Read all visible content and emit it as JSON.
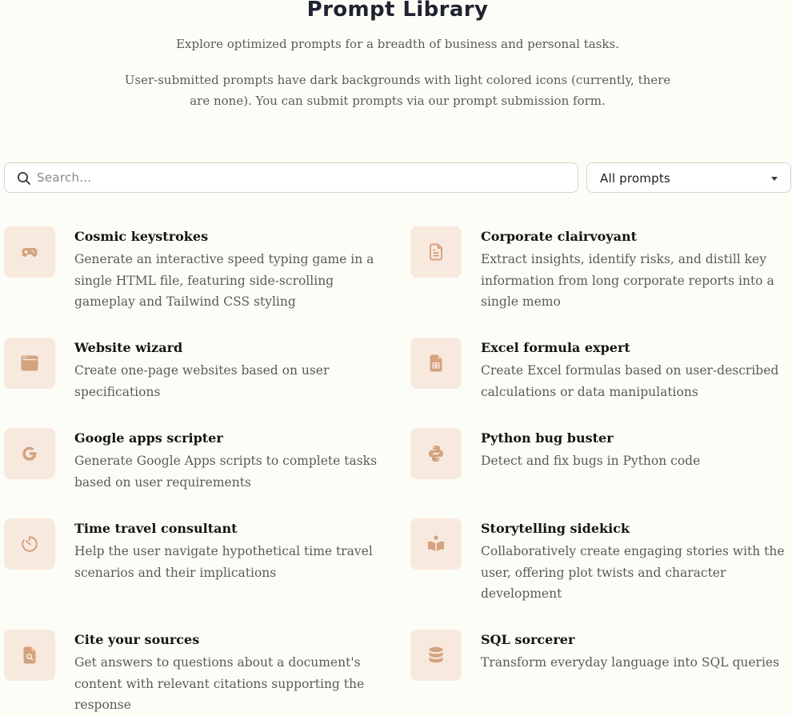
{
  "header": {
    "title": "Prompt Library",
    "subtitle": "Explore optimized prompts for a breadth of business and personal tasks.",
    "note": "User-submitted prompts have dark backgrounds with light colored icons (currently, there are none). You can submit prompts via our prompt submission form."
  },
  "search": {
    "placeholder": "Search...",
    "value": ""
  },
  "filter": {
    "selected": "All prompts"
  },
  "colors": {
    "icon_tile_bg": "#f8e9df",
    "icon_color": "#d4a27f",
    "background": "#fdfdf7"
  },
  "prompts": [
    {
      "title": "Cosmic keystrokes",
      "description": "Generate an interactive speed typing game in a single HTML file, featuring side-scrolling gameplay and Tailwind CSS styling",
      "icon": "gamepad-icon"
    },
    {
      "title": "Corporate clairvoyant",
      "description": "Extract insights, identify risks, and distill key information from long corporate reports into a single memo",
      "icon": "document-icon"
    },
    {
      "title": "Website wizard",
      "description": "Create one-page websites based on user specifications",
      "icon": "browser-window-icon"
    },
    {
      "title": "Excel formula expert",
      "description": "Create Excel formulas based on user-described calculations or data manipulations",
      "icon": "spreadsheet-icon"
    },
    {
      "title": "Google apps scripter",
      "description": "Generate Google Apps scripts to complete tasks based on user requirements",
      "icon": "google-icon"
    },
    {
      "title": "Python bug buster",
      "description": "Detect and fix bugs in Python code",
      "icon": "python-icon"
    },
    {
      "title": "Time travel consultant",
      "description": "Help the user navigate hypothetical time travel scenarios and their implications",
      "icon": "timer-icon"
    },
    {
      "title": "Storytelling sidekick",
      "description": "Collaboratively create engaging stories with the user, offering plot twists and character development",
      "icon": "book-icon"
    },
    {
      "title": "Cite your sources",
      "description": "Get answers to questions about a document's content with relevant citations supporting the response",
      "icon": "document-search-icon"
    },
    {
      "title": "SQL sorcerer",
      "description": "Transform everyday language into SQL queries",
      "icon": "database-icon"
    }
  ]
}
